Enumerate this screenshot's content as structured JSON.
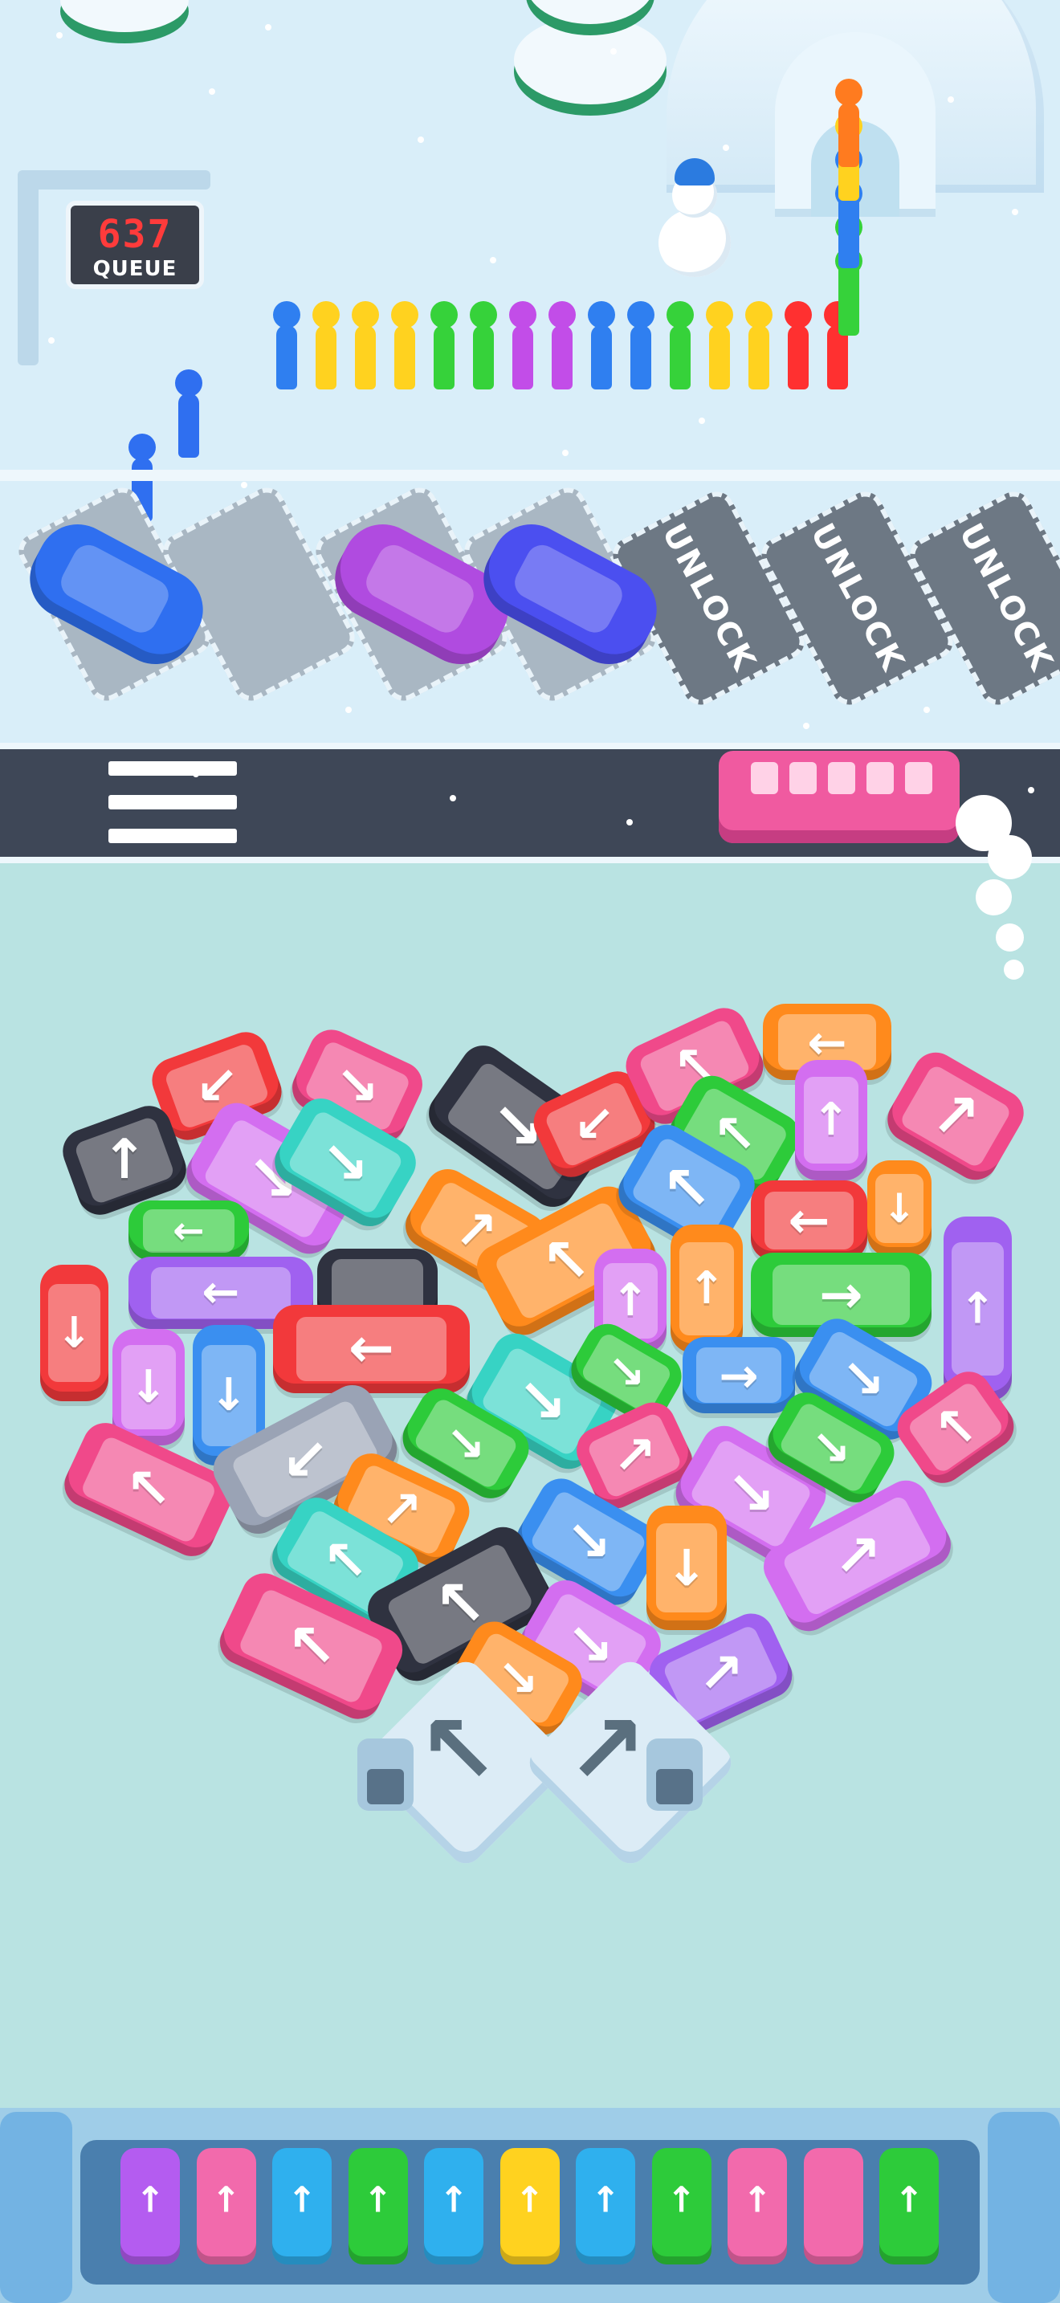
{
  "queue_sign": {
    "count": "637",
    "label": "QUEUE"
  },
  "queue_people": [
    "#2f7ff0",
    "#ffd21f",
    "#ffd21f",
    "#ffd21f",
    "#36d23a",
    "#36d23a",
    "#c24de8",
    "#c24de8",
    "#2f7ff0",
    "#2f7ff0",
    "#36d23a",
    "#ffd21f",
    "#ffd21f",
    "#ff3030",
    "#ff3030",
    "#36d23a",
    "#36d23a",
    "#2f7ff0",
    "#2f7ff0",
    "#ffd21f",
    "#ff7b1f"
  ],
  "parking": {
    "occupied_colors": [
      "#2f6ff0",
      "#b04be0",
      "#4b4ff0"
    ],
    "unlock_label": "UNLOCK",
    "locked_spots": 3
  },
  "road_bus_color": "#f05aa0",
  "vehicle_colors": {
    "red": "#f2393b",
    "pink": "#f0498a",
    "orange": "#ff8a1c",
    "green": "#2dcb3a",
    "teal": "#37d3c4",
    "blue": "#3a8ff0",
    "purple": "#a061f0",
    "violet": "#d36ef0",
    "black": "#2f3240",
    "gray": "#9aa3b5"
  },
  "exit_gates": {
    "left_arrow": "↖",
    "right_arrow": "↗"
  },
  "tray_cars": [
    {
      "color": "#b45cf0",
      "arrow": "↑"
    },
    {
      "color": "#f26aac",
      "arrow": "↑"
    },
    {
      "color": "#2fb0ee",
      "arrow": "↑"
    },
    {
      "color": "#2dcb3a",
      "arrow": "↑"
    },
    {
      "color": "#2fb0ee",
      "arrow": "↑"
    },
    {
      "color": "#ffd21f",
      "arrow": "↑"
    },
    {
      "color": "#2fb0ee",
      "arrow": "↑"
    },
    {
      "color": "#2dcb3a",
      "arrow": "↑"
    },
    {
      "color": "#f26aac",
      "arrow": "↑"
    },
    {
      "color": "#f26aac",
      "arrow": ""
    },
    {
      "color": "#2dcb3a",
      "arrow": "↑"
    }
  ]
}
